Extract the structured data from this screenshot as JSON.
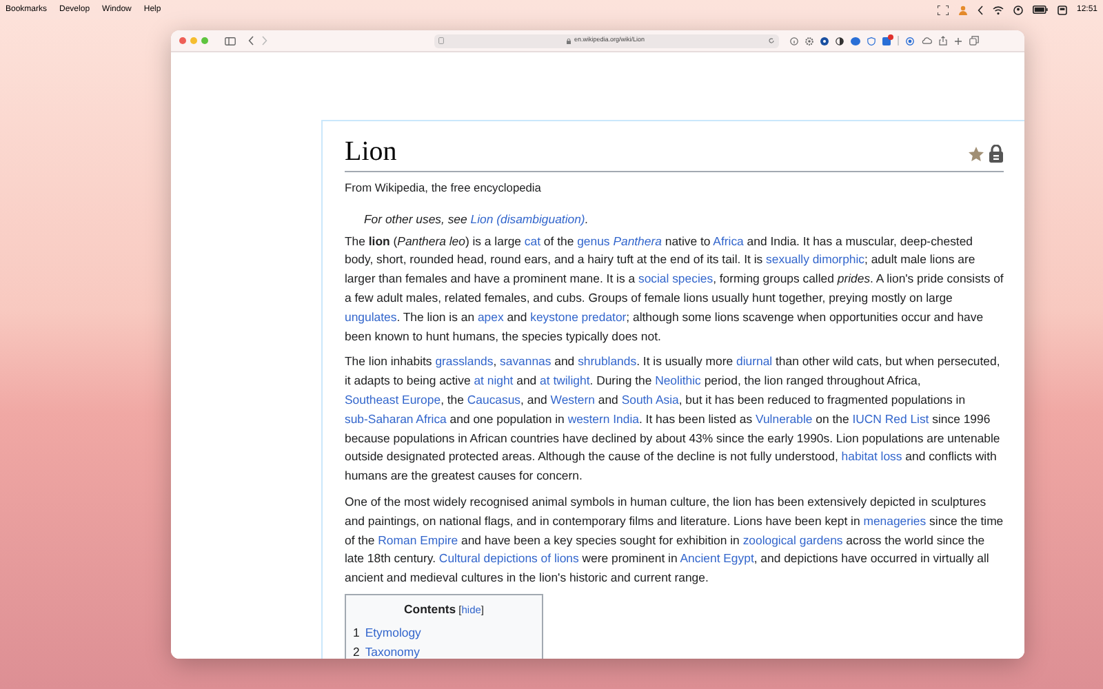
{
  "menu_bar": {
    "items": [
      "Bookmarks",
      "Develop",
      "Window",
      "Help"
    ],
    "clock": "12:51"
  },
  "browser": {
    "address": "en.wikipedia.org/wiki/Lion"
  },
  "article": {
    "title": "Lion",
    "tagline": "From Wikipedia, the free encyclopedia",
    "hatnote": [
      {
        "kind": "text",
        "text": "For other uses, see "
      },
      {
        "kind": "link",
        "text": "Lion (disambiguation)"
      },
      {
        "kind": "text",
        "text": "."
      }
    ],
    "paragraphs": [
      [
        {
          "kind": "text",
          "text": "The "
        },
        {
          "kind": "bold",
          "text": "lion"
        },
        {
          "kind": "text",
          "text": " ("
        },
        {
          "kind": "italic",
          "text": "Panthera leo"
        },
        {
          "kind": "text",
          "text": ") is a large "
        },
        {
          "kind": "link",
          "text": "cat"
        },
        {
          "kind": "text",
          "text": " of the "
        },
        {
          "kind": "link",
          "text": "genus "
        },
        {
          "kind": "link_italic",
          "text": "Panthera"
        },
        {
          "kind": "text",
          "text": " native to "
        },
        {
          "kind": "link",
          "text": "Africa"
        },
        {
          "kind": "text",
          "text": " and India. It has a muscular, deep-chested body, short, rounded head, round ears, and a hairy tuft at the end of its tail. It is "
        },
        {
          "kind": "link",
          "text": "sexually dimorphic"
        },
        {
          "kind": "text",
          "text": "; adult male lions are larger than females and have a prominent mane. It is a "
        },
        {
          "kind": "link",
          "text": "social species"
        },
        {
          "kind": "text",
          "text": ", forming groups called "
        },
        {
          "kind": "italic",
          "text": "prides"
        },
        {
          "kind": "text",
          "text": ". A lion's pride consists of a few adult males, related females, and cubs. Groups of female lions usually hunt together, preying mostly on large "
        },
        {
          "kind": "link",
          "text": "ungulates"
        },
        {
          "kind": "text",
          "text": ". The lion is an "
        },
        {
          "kind": "link",
          "text": "apex"
        },
        {
          "kind": "text",
          "text": " and "
        },
        {
          "kind": "link",
          "text": "keystone predator"
        },
        {
          "kind": "text",
          "text": "; although some lions scavenge when opportunities occur and have been known to hunt humans, the species typically does not."
        }
      ],
      [
        {
          "kind": "text",
          "text": "The lion inhabits "
        },
        {
          "kind": "link",
          "text": "grasslands"
        },
        {
          "kind": "text",
          "text": ", "
        },
        {
          "kind": "link",
          "text": "savannas"
        },
        {
          "kind": "text",
          "text": " and "
        },
        {
          "kind": "link",
          "text": "shrublands"
        },
        {
          "kind": "text",
          "text": ". It is usually more "
        },
        {
          "kind": "link",
          "text": "diurnal"
        },
        {
          "kind": "text",
          "text": " than other wild cats, but when persecuted, it adapts to being active "
        },
        {
          "kind": "link",
          "text": "at night"
        },
        {
          "kind": "text",
          "text": " and "
        },
        {
          "kind": "link",
          "text": "at twilight"
        },
        {
          "kind": "text",
          "text": ". During the "
        },
        {
          "kind": "link",
          "text": "Neolithic"
        },
        {
          "kind": "text",
          "text": " period, the lion ranged throughout Africa, "
        },
        {
          "kind": "link",
          "text": "Southeast Europe"
        },
        {
          "kind": "text",
          "text": ", the "
        },
        {
          "kind": "link",
          "text": "Caucasus"
        },
        {
          "kind": "text",
          "text": ", and "
        },
        {
          "kind": "link",
          "text": "Western"
        },
        {
          "kind": "text",
          "text": " and "
        },
        {
          "kind": "link",
          "text": "South Asia"
        },
        {
          "kind": "text",
          "text": ", but it has been reduced to fragmented populations in "
        },
        {
          "kind": "link",
          "text": "sub-Saharan Africa"
        },
        {
          "kind": "text",
          "text": " and one population in "
        },
        {
          "kind": "link",
          "text": "western India"
        },
        {
          "kind": "text",
          "text": ". It has been listed as "
        },
        {
          "kind": "link",
          "text": "Vulnerable"
        },
        {
          "kind": "text",
          "text": " on the "
        },
        {
          "kind": "link",
          "text": "IUCN Red List"
        },
        {
          "kind": "text",
          "text": " since 1996 because populations in African countries have declined by about 43% since the early 1990s. Lion populations are untenable outside designated protected areas. Although the cause of the decline is not fully understood, "
        },
        {
          "kind": "link",
          "text": "habitat loss"
        },
        {
          "kind": "text",
          "text": " and conflicts with humans are the greatest causes for concern."
        }
      ],
      [
        {
          "kind": "text",
          "text": "One of the most widely recognised animal symbols in human culture, the lion has been extensively depicted in sculptures and paintings, on national flags, and in contemporary films and literature. Lions have been kept in "
        },
        {
          "kind": "link",
          "text": "menageries"
        },
        {
          "kind": "text",
          "text": " since the time of the "
        },
        {
          "kind": "link",
          "text": "Roman Empire"
        },
        {
          "kind": "text",
          "text": " and have been a key species sought for exhibition in "
        },
        {
          "kind": "link",
          "text": "zoological gardens"
        },
        {
          "kind": "text",
          "text": " across the world since the late 18th century. "
        },
        {
          "kind": "link",
          "text": "Cultural depictions of lions"
        },
        {
          "kind": "text",
          "text": " were prominent in "
        },
        {
          "kind": "link",
          "text": "Ancient Egypt"
        },
        {
          "kind": "text",
          "text": ", and depictions have occurred in virtually all ancient and medieval cultures in the lion's historic and current range."
        }
      ]
    ],
    "contents": {
      "title": "Contents",
      "toggle": [
        {
          "kind": "text",
          "text": "["
        },
        {
          "kind": "link",
          "text": "hide"
        },
        {
          "kind": "text",
          "text": "]"
        }
      ],
      "entries": [
        {
          "number": "1",
          "label": "Etymology"
        },
        {
          "number": "2",
          "label": "Taxonomy"
        }
      ]
    }
  }
}
